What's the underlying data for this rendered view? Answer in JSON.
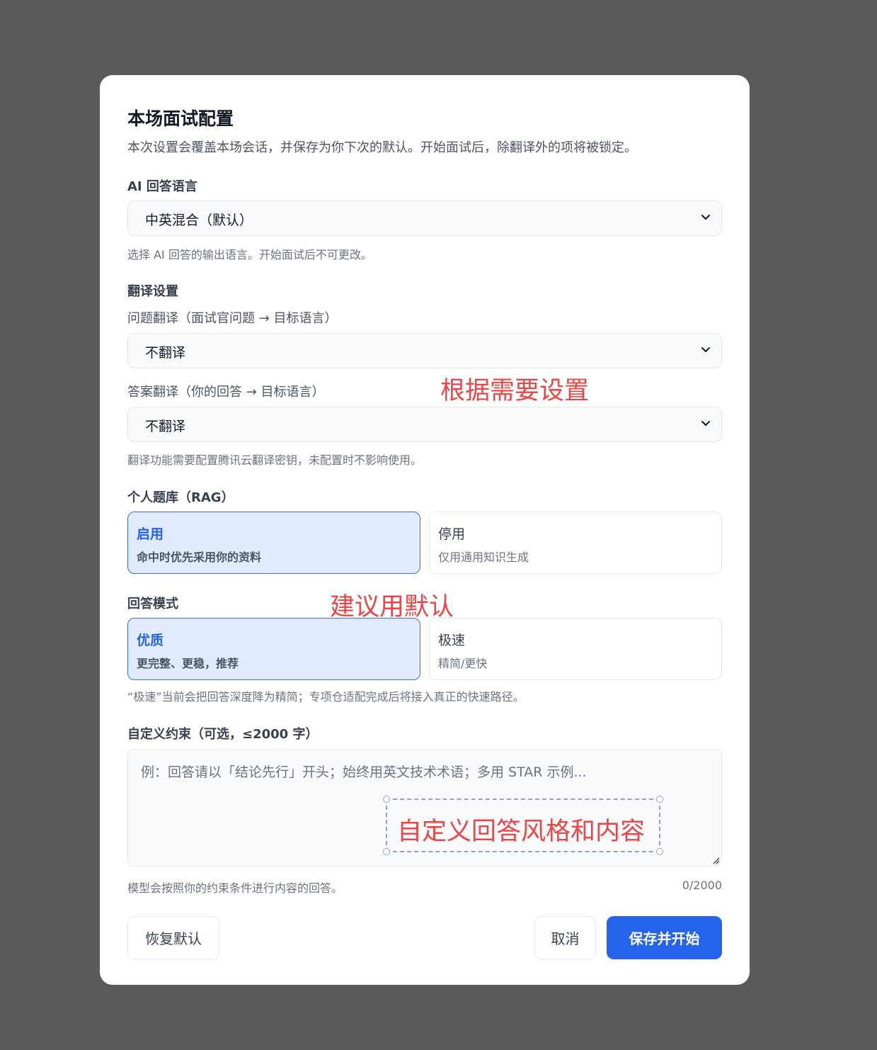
{
  "dialog": {
    "title": "本场面试配置",
    "subtitle": "本次设置会覆盖本场会话，并保存为你下次的默认。开始面试后，除翻译外的项将被锁定。"
  },
  "ai_language": {
    "label": "AI 回答语言",
    "selected": "中英混合（默认）",
    "hint": "选择 AI 回答的输出语言。开始面试后不可更改。"
  },
  "translation": {
    "label": "翻译设置",
    "question_label": "问题翻译（面试官问题 → 目标语言）",
    "question_selected": "不翻译",
    "answer_label": "答案翻译（你的回答 → 目标语言）",
    "answer_selected": "不翻译",
    "hint": "翻译功能需要配置腾讯云翻译密钥，未配置时不影响使用。"
  },
  "rag": {
    "label": "个人题库（RAG）",
    "options": [
      {
        "title": "启用",
        "desc": "命中时优先采用你的资料"
      },
      {
        "title": "停用",
        "desc": "仅用通用知识生成"
      }
    ]
  },
  "mode": {
    "label": "回答模式",
    "options": [
      {
        "title": "优质",
        "desc": "更完整、更稳，推荐"
      },
      {
        "title": "极速",
        "desc": "精简/更快"
      }
    ],
    "hint": "“极速”当前会把回答深度降为精简；专项仓适配完成后将接入真正的快速路径。"
  },
  "constraints": {
    "label": "自定义约束（可选，≤2000 字）",
    "placeholder": "例：回答请以「结论先行」开头；始终用英文技术术语；多用 STAR 示例...",
    "hint": "模型会按照你的约束条件进行内容的回答。",
    "count": "0/2000"
  },
  "buttons": {
    "reset": "恢复默认",
    "cancel": "取消",
    "save": "保存并开始"
  },
  "annotations": {
    "translation_note": "根据需要设置",
    "mode_note": "建议用默认",
    "constraints_note": "自定义回答风格和内容"
  },
  "colors": {
    "accent": "#2563eb",
    "annotation": "#ef4444",
    "selected_bg": "#e2ebfd"
  }
}
